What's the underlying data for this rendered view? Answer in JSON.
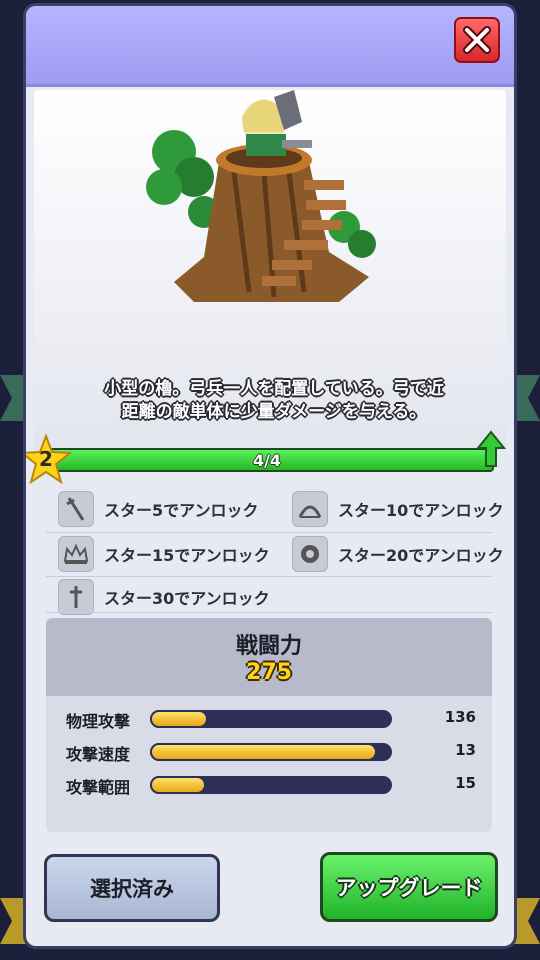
{
  "header": {
    "close_icon": "close-x-icon",
    "close_color": "#d9252d"
  },
  "unit": {
    "description_line1": "小型の櫓。弓兵一人を配置している。弓で近",
    "description_line2": "距離の敵単体に少量ダメージを与える。",
    "star_level": "2",
    "progress_text": "4/4",
    "progress_fraction": 1.0
  },
  "unlocks": [
    {
      "icon": "sword-icon",
      "label": "スター5でアンロック"
    },
    {
      "icon": "crossbow-icon",
      "label": "スター10でアンロック"
    },
    {
      "icon": "crown-icon",
      "label": "スター15でアンロック"
    },
    {
      "icon": "gear-burst-icon",
      "label": "スター20でアンロック"
    },
    {
      "icon": "sword-icon",
      "label": "スター30でアンロック"
    }
  ],
  "power": {
    "title": "戦闘力",
    "value": "275"
  },
  "stats": [
    {
      "label": "物理攻撃",
      "value": "136",
      "fill": 0.24
    },
    {
      "label": "攻撃速度",
      "value": "13",
      "fill": 0.94
    },
    {
      "label": "攻撃範囲",
      "value": "15",
      "fill": 0.23
    }
  ],
  "buttons": {
    "selected_label": "選択済み",
    "upgrade_label": "アップグレード"
  },
  "colors": {
    "header": "#b6b5ff",
    "progress": "#27b827",
    "power_value": "#ffd21c",
    "upgrade": "#1fb42a"
  }
}
